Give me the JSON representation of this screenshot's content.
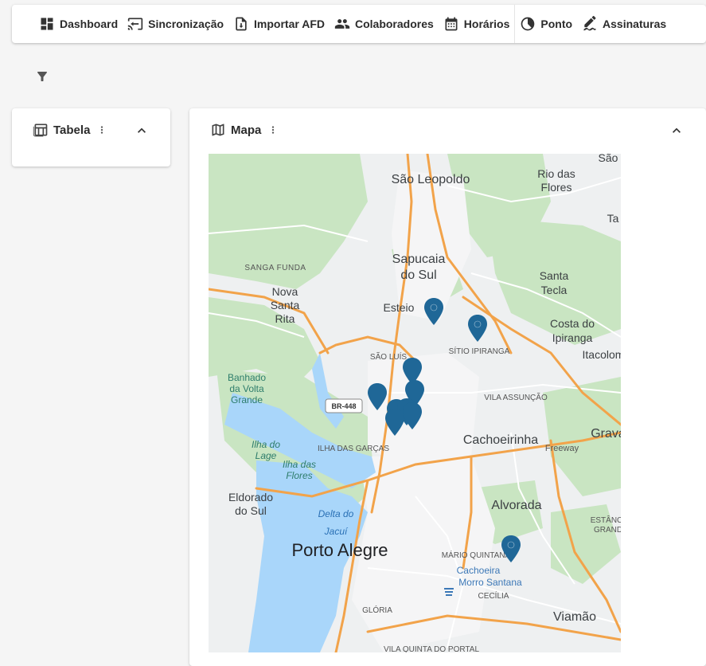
{
  "nav": [
    {
      "label": "Dashboard",
      "icon": "dashboard-icon"
    },
    {
      "label": "Sincronização",
      "icon": "sync-screen-icon"
    },
    {
      "label": "Importar AFD",
      "icon": "import-file-icon"
    },
    {
      "label": "Colaboradores",
      "icon": "people-icon"
    },
    {
      "label": "Horários",
      "icon": "calendar-icon"
    },
    {
      "label": "Ponto",
      "icon": "clock-half-icon"
    },
    {
      "label": "Assinaturas",
      "icon": "signature-icon"
    }
  ],
  "tabela": {
    "title": "Tabela"
  },
  "mapa": {
    "title": "Mapa",
    "place_labels": {
      "sao_leopoldo": "São Leopoldo",
      "rio_das": "Rio das",
      "flores": "Flores",
      "sao": "São",
      "ta": "Ta",
      "sanga_funda": "SANGA FUNDA",
      "sapucaia": "Sapucaia",
      "do_sul_1": "do Sul",
      "santa": "Santa",
      "tecla": "Tecla",
      "nova": "Nova",
      "santa_2": "Santa",
      "rita": "Rita",
      "esteio": "Esteio",
      "costa_do": "Costa do",
      "ipiranga": "Ipiranga",
      "itacolomi": "Itacolom",
      "sitio_ipiranga": "SÍTIO IPIRANGA",
      "sao_luis": "SÃO LUÍS",
      "banhado": "Banhado",
      "da_volta": "da Volta",
      "grande": "Grande",
      "vila_assuncao": "VILA ASSUNÇÃO",
      "br448": "BR-448",
      "cachoeirinha": "Cachoeirinha",
      "grava": "Grava",
      "ilha_do": "Ilha do",
      "lage": "Lage",
      "ilhas_das_garcas": "ILHA DAS GARÇAS",
      "freeway": "Freeway",
      "ilha_das": "Ilha das",
      "flores_2": "Flores",
      "eldorado": "Eldorado",
      "do_sul_2": "do Sul",
      "alvorada": "Alvorada",
      "delta_do": "Delta do",
      "jacui": "Jacuí",
      "estancia": "ESTÂNC",
      "grand": "GRAND",
      "porto_alegre": "Porto Alegre",
      "mario_quintana": "MÁRIO QUINTANA",
      "cachoeira": "Cachoeira",
      "morro_santana": "Morro Santana",
      "cecilia": "CECÍLIA",
      "gloria": "GLÓRIA",
      "viamao": "Viamão",
      "vila_nova": "VILA QUINTA DO PORTAL"
    },
    "colors": {
      "water": "#aadaff",
      "park": "#c8e6c0",
      "land": "#f1f3f4",
      "road_major": "#f2a34a",
      "pin": "#1f6797"
    }
  }
}
